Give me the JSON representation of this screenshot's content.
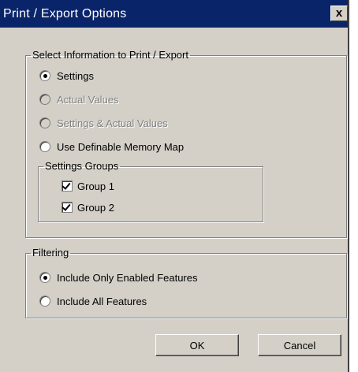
{
  "window": {
    "title": "Print / Export Options",
    "close_glyph": "x"
  },
  "select_group": {
    "legend": "Select Information to Print / Export",
    "options": [
      {
        "label": "Settings",
        "checked": true,
        "enabled": true
      },
      {
        "label": "Actual Values",
        "checked": false,
        "enabled": false
      },
      {
        "label": "Settings & Actual Values",
        "checked": false,
        "enabled": false
      },
      {
        "label": "Use Definable Memory Map",
        "checked": false,
        "enabled": true
      }
    ],
    "settings_groups": {
      "legend": "Settings Groups",
      "items": [
        {
          "label": "Group 1",
          "checked": true
        },
        {
          "label": "Group 2",
          "checked": true
        }
      ]
    }
  },
  "filtering_group": {
    "legend": "Filtering",
    "options": [
      {
        "label": "Include Only Enabled Features",
        "checked": true
      },
      {
        "label": "Include All Features",
        "checked": false
      }
    ]
  },
  "buttons": {
    "ok": "OK",
    "cancel": "Cancel"
  },
  "colors": {
    "titlebar": "#0a246a",
    "dialog_face": "#d4d0c8",
    "disabled_text": "#808080"
  }
}
